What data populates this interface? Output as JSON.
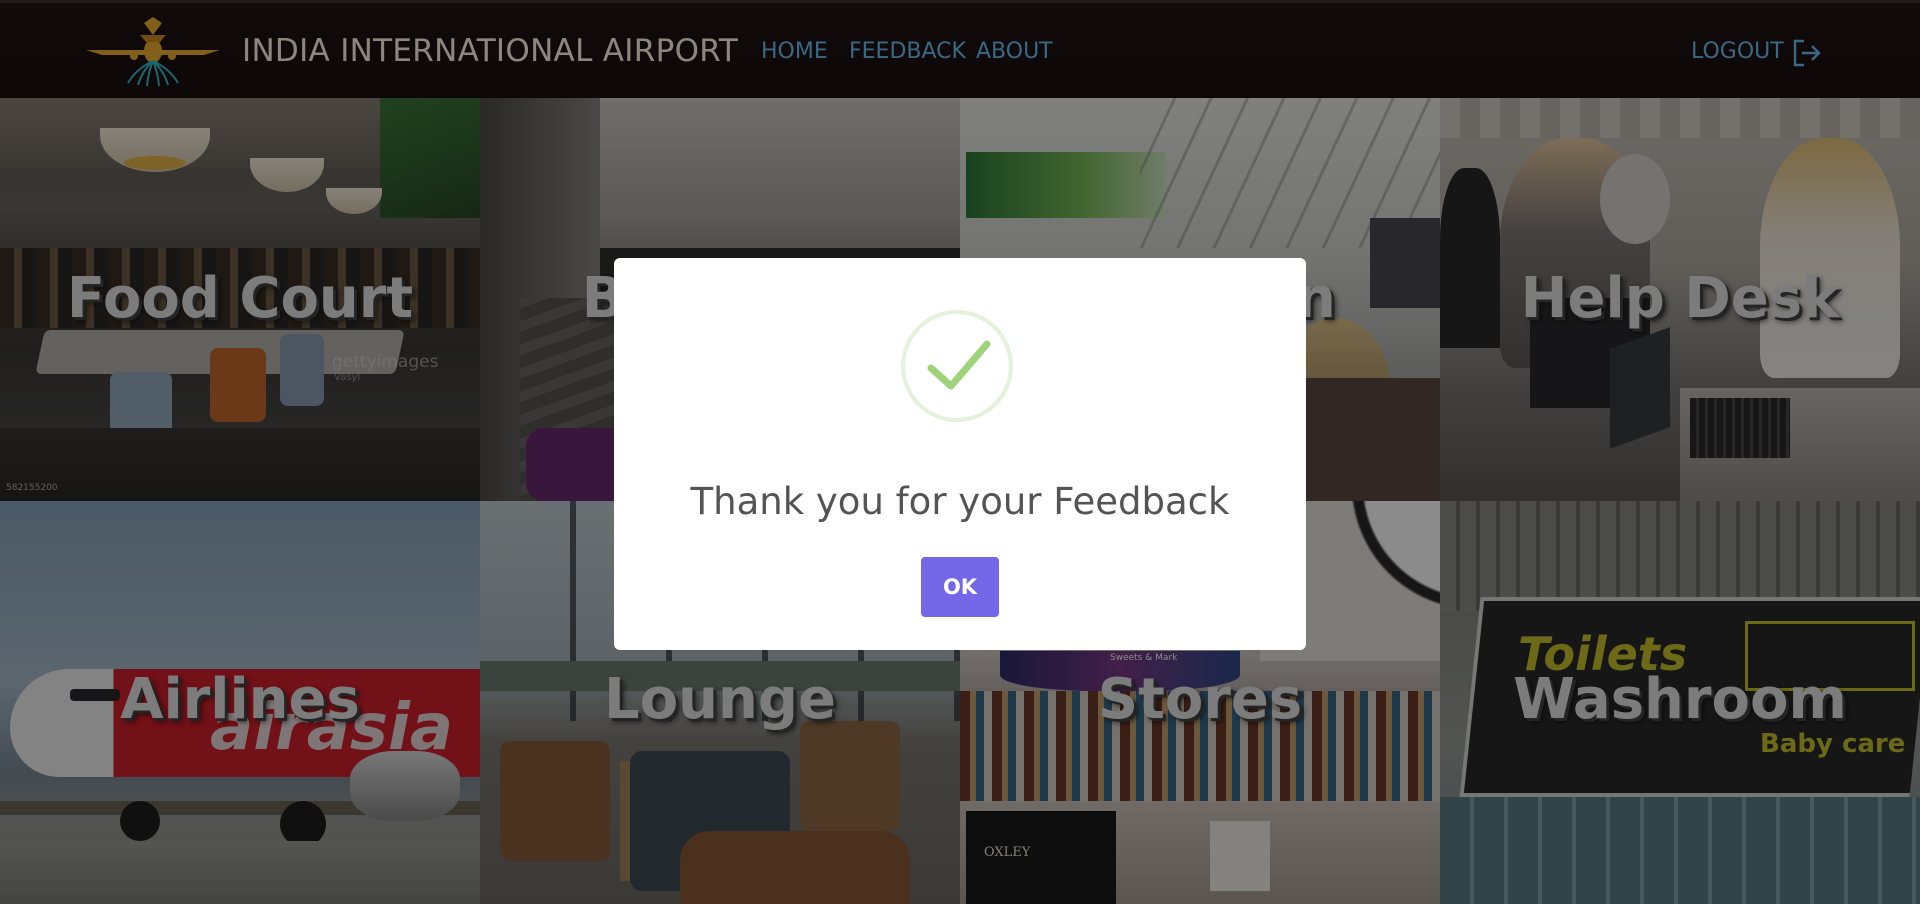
{
  "navbar": {
    "brand": "INDIA INTERNATIONAL AIRPORT",
    "links": [
      {
        "label": "HOME"
      },
      {
        "label": "FEEDBACK"
      },
      {
        "label": "ABOUT"
      }
    ],
    "logout_label": "LOGOUT",
    "logo_icon": "airplane-logo-icon",
    "logout_icon": "logout-arrow-icon",
    "link_color": "#5ea8d6"
  },
  "tiles": [
    {
      "label": "Food Court",
      "overlay_text": "gettyimages",
      "overlay_subtext": "Vasyl",
      "corner_text": "582155200"
    },
    {
      "label": "Baggage"
    },
    {
      "label": "Check-in"
    },
    {
      "label": "Help Desk"
    },
    {
      "label": "Airlines",
      "livery_text": "airasia"
    },
    {
      "label": "Lounge"
    },
    {
      "label": "Stores",
      "store_sign": "OXLEY",
      "shop_sign": "Sweets & Mark"
    },
    {
      "label": "Washroom",
      "sign_text": "Toilets",
      "sign_subtext": "Baby care"
    }
  ],
  "modal": {
    "title": "Thank you for your Feedback",
    "ok_label": "OK",
    "icon": "success-check-icon",
    "accent_color": "#7367e8",
    "check_color": "#9dd47a"
  }
}
